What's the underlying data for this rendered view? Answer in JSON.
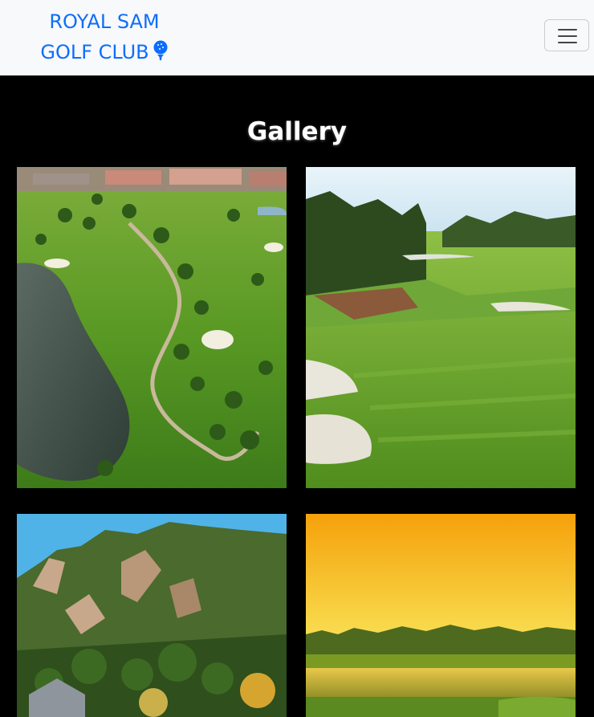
{
  "navbar": {
    "brand_line1": "ROYAL SAM",
    "brand_line2": "GOLF CLUB",
    "brand_icon": "golf-ball-tee-icon",
    "menu_icon": "hamburger-menu-icon",
    "brand_color": "#0d6efd",
    "background": "#f8f9fa"
  },
  "gallery": {
    "title": "Gallery",
    "images": [
      {
        "name": "aerial-golf-course-with-lake-photo"
      },
      {
        "name": "green-fairway-with-pine-trees-photo"
      },
      {
        "name": "mountain-cliffs-and-forest-photo"
      },
      {
        "name": "sunset-over-golf-course-lake-photo"
      }
    ]
  }
}
